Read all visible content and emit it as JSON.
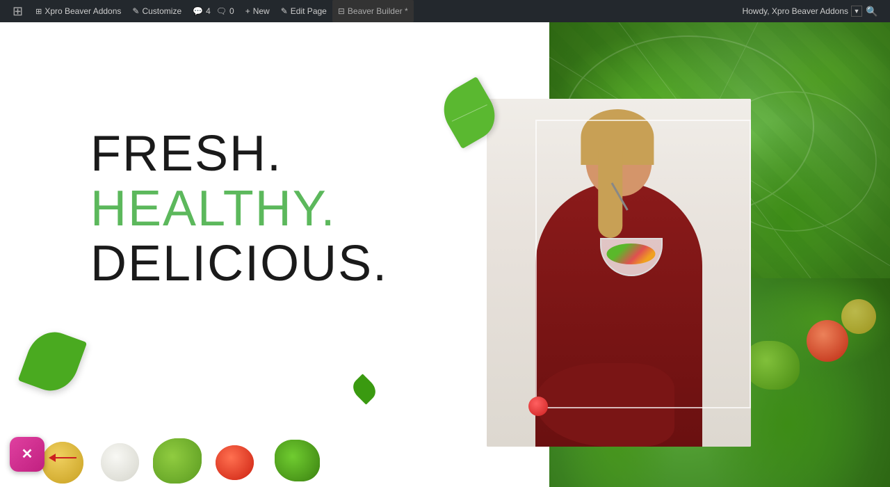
{
  "adminBar": {
    "wpIcon": "⊞",
    "items": [
      {
        "id": "xpro-beaver-addons",
        "label": "Xpro Beaver Addons",
        "icon": "⊞"
      },
      {
        "id": "customize",
        "label": "Customize",
        "icon": "✎"
      },
      {
        "id": "comments",
        "label": "4",
        "icon": "💬",
        "sub": "0"
      },
      {
        "id": "new",
        "label": "New",
        "icon": "+"
      },
      {
        "id": "edit-page",
        "label": "Edit Page",
        "icon": "✎"
      },
      {
        "id": "beaver-builder",
        "label": "Beaver Builder *",
        "icon": "⊟"
      }
    ],
    "right": {
      "howdy": "Howdy, Xpro Beaver Addons",
      "avatarIcon": "👤",
      "searchIcon": "🔍"
    }
  },
  "hero": {
    "line1": "FRESH.",
    "line2": "HEALTHY.",
    "line3": "DELICIOUS."
  },
  "ui": {
    "closeButtonIcon": "✕",
    "arrowColor": "#cc2020"
  }
}
